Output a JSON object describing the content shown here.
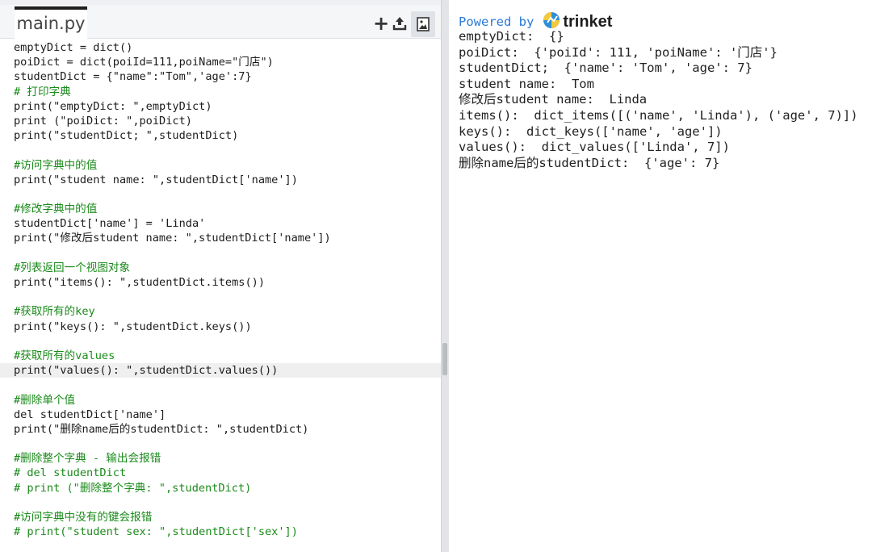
{
  "editor": {
    "filename": "main.py",
    "toolbar": {
      "add_icon": "plus-icon",
      "upload_icon": "upload-icon",
      "image_icon": "image-icon"
    },
    "code_lines": [
      "emptyDict = dict()",
      "poiDict = dict(poiId=111,poiName=\"门店\")",
      "studentDict = {\"name\":\"Tom\",'age':7}",
      "# 打印字典",
      "print(\"emptyDict: \",emptyDict)",
      "print (\"poiDict: \",poiDict)",
      "print(\"studentDict; \",studentDict)",
      "",
      "#访问字典中的值",
      "print(\"student name: \",studentDict['name'])",
      "",
      "#修改字典中的值",
      "studentDict['name'] = 'Linda'",
      "print(\"修改后student name: \",studentDict['name'])",
      "",
      "#列表返回一个视图对象",
      "print(\"items(): \",studentDict.items())",
      "",
      "#获取所有的key",
      "print(\"keys(): \",studentDict.keys())",
      "",
      "#获取所有的values",
      "print(\"values(): \",studentDict.values())",
      "",
      "#删除单个值",
      "del studentDict['name']",
      "print(\"删除name后的studentDict: \",studentDict)",
      "",
      "#删除整个字典 - 输出会报错",
      "# del studentDict",
      "# print (\"删除整个字典: \",studentDict)",
      "",
      "#访问字典中没有的键会报错",
      "# print(\"student sex: \",studentDict['sex'])"
    ]
  },
  "output": {
    "powered_by": "Powered by",
    "brand_name": "trinket",
    "lines": [
      "emptyDict:  {}",
      "poiDict:  {'poiId': 111, 'poiName': '门店'}",
      "studentDict;  {'name': 'Tom', 'age': 7}",
      "student name:  Tom",
      "修改后student name:  Linda",
      "items():  dict_items([('name', 'Linda'), ('age', 7)])",
      "keys():  dict_keys(['name', 'age'])",
      "values():  dict_values(['Linda', 7])",
      "删除name后的studentDict:  {'age': 7}"
    ]
  },
  "colors": {
    "comment": "#1a8a1a",
    "string": "#c41a16",
    "keyword": "#8a1aaa",
    "number": "#1a1aa6",
    "brand_blue": "#2a7ad8"
  }
}
